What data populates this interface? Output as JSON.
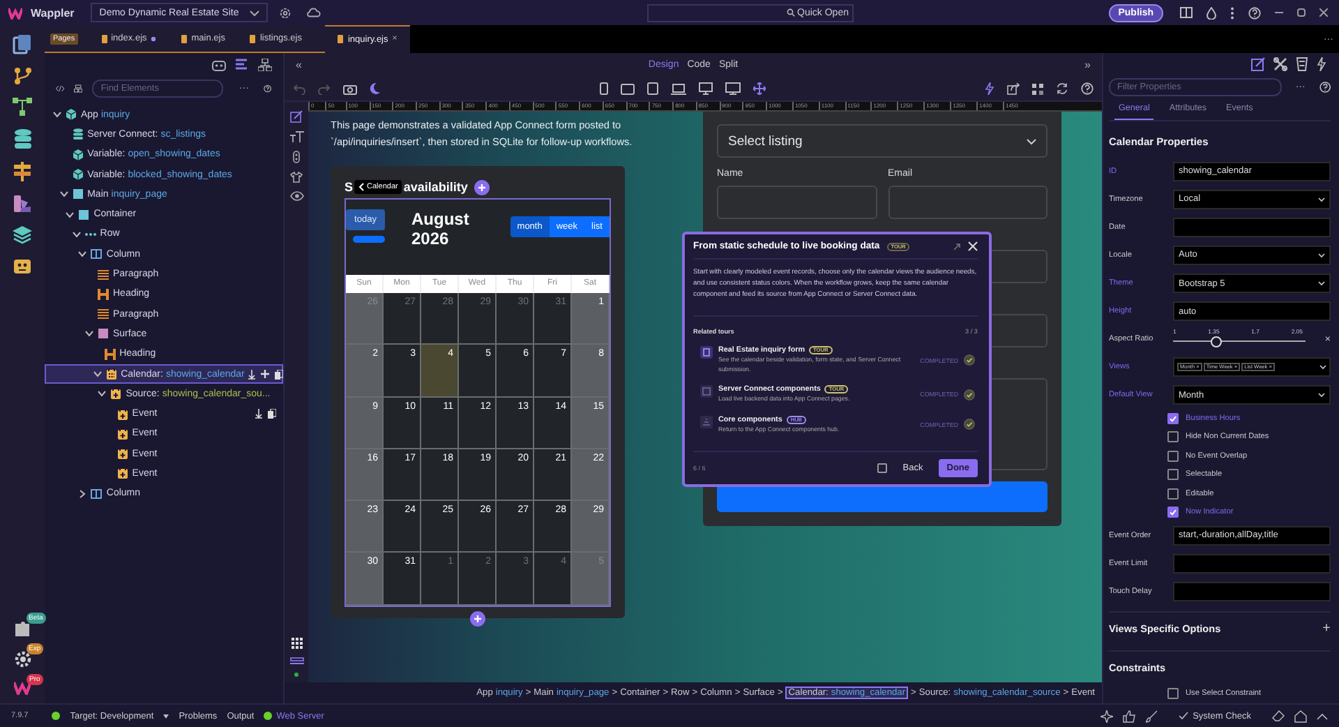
{
  "app": {
    "logo": "Wappler",
    "project": "Demo Dynamic Real Estate Site",
    "quick_open": "Quick Open",
    "publish": "Publish"
  },
  "left_rail": {
    "bottom": [
      {
        "kind": "puzzle",
        "badge": "Beta",
        "color": "#3a9e8f"
      },
      {
        "kind": "gear",
        "badge": "Exp",
        "color": "#c9822c"
      },
      {
        "kind": "logo",
        "badge": "Pro",
        "color": "#d8344c"
      }
    ]
  },
  "file_tabs": {
    "badge": "Pages",
    "more": "···",
    "tabs": [
      {
        "label": "index.ejs",
        "selected": false,
        "modified": true
      },
      {
        "label": "main.ejs",
        "selected": false,
        "modified": false
      },
      {
        "label": "listings.ejs",
        "selected": false,
        "modified": false
      },
      {
        "label": "inquiry.ejs",
        "selected": true,
        "modified": false,
        "close": "×"
      }
    ]
  },
  "structure": {
    "search": {
      "placeholder": "Find Elements"
    },
    "more": "···",
    "tree": [
      {
        "kind": "app",
        "label": "App",
        "name": "inquiry",
        "expanded": true,
        "selected": false,
        "hovered": false,
        "children": [
          {
            "kind": "server-connect",
            "label": "Server Connect:",
            "name": "sc_listings",
            "selected": false,
            "hovered": false
          },
          {
            "kind": "variable",
            "label": "Variable:",
            "name": "open_showing_dates",
            "selected": false,
            "hovered": false
          },
          {
            "kind": "variable",
            "label": "Variable:",
            "name": "blocked_showing_dates",
            "selected": false,
            "hovered": false
          },
          {
            "kind": "main",
            "label": "Main",
            "name": "inquiry_page",
            "expanded": true,
            "selected": false,
            "hovered": false,
            "children": [
              {
                "kind": "container",
                "label": "Container",
                "expanded": true,
                "selected": false,
                "hovered": false,
                "children": [
                  {
                    "kind": "row",
                    "label": "Row",
                    "expanded": true,
                    "selected": false,
                    "hovered": false,
                    "children": [
                      {
                        "kind": "column",
                        "label": "Column",
                        "expanded": true,
                        "selected": false,
                        "hovered": false,
                        "children": [
                          {
                            "kind": "paragraph",
                            "label": "Paragraph",
                            "selected": false,
                            "hovered": false
                          },
                          {
                            "kind": "heading",
                            "label": "Heading",
                            "selected": false,
                            "hovered": false
                          },
                          {
                            "kind": "paragraph",
                            "label": "Paragraph",
                            "selected": false,
                            "hovered": false
                          },
                          {
                            "kind": "surface",
                            "label": "Surface",
                            "expanded": true,
                            "selected": false,
                            "hovered": false,
                            "children": [
                              {
                                "kind": "heading",
                                "label": "Heading",
                                "selected": false,
                                "hovered": false
                              },
                              {
                                "kind": "calendar",
                                "label": "Calendar:",
                                "name": "showing_calendar",
                                "expanded": true,
                                "selected": true,
                                "hovered": false,
                                "children": [
                                  {
                                    "kind": "source",
                                    "label": "Source:",
                                    "name": "showing_calendar_sou...",
                                    "expanded": true,
                                    "selected": false,
                                    "hovered": false,
                                    "children": [
                                      {
                                        "kind": "event",
                                        "label": "Event",
                                        "selected": false,
                                        "hovered": true
                                      },
                                      {
                                        "kind": "event",
                                        "label": "Event",
                                        "selected": false,
                                        "hovered": false
                                      },
                                      {
                                        "kind": "event",
                                        "label": "Event",
                                        "selected": false,
                                        "hovered": false
                                      },
                                      {
                                        "kind": "event",
                                        "label": "Event",
                                        "selected": false,
                                        "hovered": false
                                      }
                                    ]
                                  }
                                ]
                              }
                            ]
                          }
                        ]
                      },
                      {
                        "kind": "column",
                        "label": "Column",
                        "expanded": false,
                        "selected": false,
                        "hovered": false
                      }
                    ]
                  }
                ]
              }
            ]
          }
        ]
      }
    ]
  },
  "view_modes": {
    "collapse_left": "«",
    "collapse_right": "»",
    "modes": [
      {
        "label": "Design",
        "selected": true
      },
      {
        "label": "Code",
        "selected": false
      },
      {
        "label": "Split",
        "selected": false
      }
    ]
  },
  "ruler": [
    "0",
    "50",
    "100",
    "150",
    "200",
    "250",
    "300",
    "350",
    "400",
    "450",
    "500",
    "550",
    "600",
    "650",
    "700",
    "750",
    "800",
    "850",
    "900",
    "950",
    "1000",
    "1050",
    "1100",
    "1150",
    "1200",
    "1250",
    "1300",
    "1350",
    "1400",
    "1450"
  ],
  "canvas": {
    "intro": "This page demonstrates a validated App Connect form posted to `/api/inquiries/insert`, then stored in SQLite for follow-up workflows.",
    "calendar_card": {
      "heading_start": "S",
      "heading_end": "availability",
      "tooltip": "Calendar",
      "calendar": {
        "today": "today",
        "title": "August 2026",
        "views": [
          {
            "label": "month",
            "selected": true
          },
          {
            "label": "week",
            "selected": false
          },
          {
            "label": "list",
            "selected": false
          }
        ],
        "weekdays": [
          "Sun",
          "Mon",
          "Tue",
          "Wed",
          "Thu",
          "Fri",
          "Sat"
        ],
        "weeks": [
          [
            {
              "day": "26",
              "muted": true,
              "today": false
            },
            {
              "day": "27",
              "muted": true,
              "today": false
            },
            {
              "day": "28",
              "muted": true,
              "today": false
            },
            {
              "day": "29",
              "muted": true,
              "today": false
            },
            {
              "day": "30",
              "muted": true,
              "today": false
            },
            {
              "day": "31",
              "muted": true,
              "today": false
            },
            {
              "day": "1",
              "muted": false,
              "today": false
            }
          ],
          [
            {
              "day": "2",
              "muted": false,
              "today": false
            },
            {
              "day": "3",
              "muted": false,
              "today": false
            },
            {
              "day": "4",
              "muted": false,
              "today": true
            },
            {
              "day": "5",
              "muted": false,
              "today": false
            },
            {
              "day": "6",
              "muted": false,
              "today": false
            },
            {
              "day": "7",
              "muted": false,
              "today": false
            },
            {
              "day": "8",
              "muted": false,
              "today": false
            }
          ],
          [
            {
              "day": "9",
              "muted": false,
              "today": false
            },
            {
              "day": "10",
              "muted": false,
              "today": false
            },
            {
              "day": "11",
              "muted": false,
              "today": false
            },
            {
              "day": "12",
              "muted": false,
              "today": false
            },
            {
              "day": "13",
              "muted": false,
              "today": false
            },
            {
              "day": "14",
              "muted": false,
              "today": false
            },
            {
              "day": "15",
              "muted": false,
              "today": false
            }
          ],
          [
            {
              "day": "16",
              "muted": false,
              "today": false
            },
            {
              "day": "17",
              "muted": false,
              "today": false
            },
            {
              "day": "18",
              "muted": false,
              "today": false
            },
            {
              "day": "19",
              "muted": false,
              "today": false
            },
            {
              "day": "20",
              "muted": false,
              "today": false
            },
            {
              "day": "21",
              "muted": false,
              "today": false
            },
            {
              "day": "22",
              "muted": false,
              "today": false
            }
          ],
          [
            {
              "day": "23",
              "muted": false,
              "today": false
            },
            {
              "day": "24",
              "muted": false,
              "today": false
            },
            {
              "day": "25",
              "muted": false,
              "today": false
            },
            {
              "day": "26",
              "muted": false,
              "today": false
            },
            {
              "day": "27",
              "muted": false,
              "today": false
            },
            {
              "day": "28",
              "muted": false,
              "today": false
            },
            {
              "day": "29",
              "muted": false,
              "today": false
            }
          ],
          [
            {
              "day": "30",
              "muted": false,
              "today": false
            },
            {
              "day": "31",
              "muted": false,
              "today": false
            },
            {
              "day": "1",
              "muted": true,
              "today": false
            },
            {
              "day": "2",
              "muted": true,
              "today": false
            },
            {
              "day": "3",
              "muted": true,
              "today": false
            },
            {
              "day": "4",
              "muted": true,
              "today": false
            },
            {
              "day": "5",
              "muted": true,
              "today": false
            }
          ]
        ]
      }
    },
    "form": {
      "select": "Select listing",
      "fields": [
        {
          "label": "Name"
        },
        {
          "label": "Email"
        }
      ]
    },
    "tour": {
      "title": "From static schedule to live booking data",
      "badge": "TOUR",
      "body": "Start with clearly modeled event records, choose only the calendar views the audience needs, and use consistent status colors. When the workflow grows, keep the same calendar component and feed its source from App Connect or Server Connect data.",
      "related_label": "Related tours",
      "related_count": "3 / 3",
      "items": [
        {
          "kind": "form",
          "title": "Real Estate inquiry form",
          "badge": "TOUR",
          "color": "#c9c56a",
          "desc": "See the calendar beside validation, form state, and Server Connect submission.",
          "status": "COMPLETED",
          "completed": true
        },
        {
          "kind": "server",
          "title": "Server Connect components",
          "badge": "TOUR",
          "color": "#c9c56a",
          "desc": "Load live backend data into App Connect pages.",
          "status": "COMPLETED",
          "completed": true
        },
        {
          "kind": "hub",
          "title": "Core components",
          "badge": "HUB",
          "color": "#9d8cf0",
          "desc": "Return to the App Connect components hub.",
          "status": "COMPLETED",
          "completed": true
        }
      ],
      "step": "6 / 6",
      "dont_show": false,
      "back": "Back",
      "done": "Done"
    }
  },
  "breadcrumb": {
    "separator": ">",
    "items": [
      {
        "label": "App",
        "name": "inquiry",
        "selected": false
      },
      {
        "label": "Main",
        "name": "inquiry_page",
        "selected": false
      },
      {
        "label": "Container",
        "selected": false
      },
      {
        "label": "Row",
        "selected": false
      },
      {
        "label": "Column",
        "selected": false
      },
      {
        "label": "Surface",
        "selected": false
      },
      {
        "label": "Calendar:",
        "name": "showing_calendar",
        "selected": true
      },
      {
        "label": "Source:",
        "name": "showing_calendar_source",
        "selected": false
      },
      {
        "label": "Event",
        "selected": false
      }
    ]
  },
  "properties": {
    "filter": {
      "placeholder": "Filter Properties"
    },
    "more": "···",
    "tabs": [
      {
        "label": "General",
        "selected": true
      },
      {
        "label": "Attributes",
        "selected": false
      },
      {
        "label": "Events",
        "selected": false
      }
    ],
    "section": "Calendar Properties",
    "rows": [
      {
        "kind": "input",
        "label": "ID",
        "set": true,
        "value": "showing_calendar"
      },
      {
        "kind": "select",
        "label": "Timezone",
        "set": false,
        "value": "Local"
      },
      {
        "kind": "input",
        "label": "Date",
        "set": false
      },
      {
        "kind": "select",
        "label": "Locale",
        "set": false,
        "value": "Auto"
      },
      {
        "kind": "select",
        "label": "Theme",
        "set": true,
        "value": "Bootstrap 5"
      },
      {
        "kind": "input",
        "label": "Height",
        "set": true,
        "value": "auto"
      },
      {
        "kind": "slider",
        "label": "Aspect Ratio",
        "set": false,
        "ticks": [
          "1",
          "1.35",
          "1.7",
          "2.05"
        ],
        "level": 0.33,
        "clear": "×"
      },
      {
        "kind": "tags",
        "label": "Views",
        "set": true,
        "tags": [
          "Month",
          "Time Week",
          "List Week"
        ],
        "remove": "×"
      },
      {
        "kind": "select",
        "label": "Default View",
        "set": true,
        "value": "Month"
      },
      {
        "kind": "check",
        "label": "Business Hours",
        "checked": true
      },
      {
        "kind": "check",
        "label": "Hide Non Current Dates",
        "checked": false
      },
      {
        "kind": "check",
        "label": "No Event Overlap",
        "checked": false
      },
      {
        "kind": "check",
        "label": "Selectable",
        "checked": false
      },
      {
        "kind": "check",
        "label": "Editable",
        "checked": false
      },
      {
        "kind": "check",
        "label": "Now Indicator",
        "checked": true
      },
      {
        "kind": "input",
        "label": "Event Order",
        "set": false,
        "value": "start,-duration,allDay,title"
      },
      {
        "kind": "input",
        "label": "Event Limit",
        "set": false
      },
      {
        "kind": "input",
        "label": "Touch Delay",
        "set": false
      }
    ],
    "groups": [
      {
        "title": "Views Specific Options",
        "expander": "+"
      },
      {
        "title": "Constraints",
        "checks": [
          {
            "label": "Use Select Constraint",
            "checked": false
          }
        ]
      }
    ]
  },
  "status_bar": {
    "version": "7.9.7",
    "target": "Target: Development",
    "problems": "Problems",
    "output": "Output",
    "server": "Web Server",
    "system_check": "System Check"
  }
}
